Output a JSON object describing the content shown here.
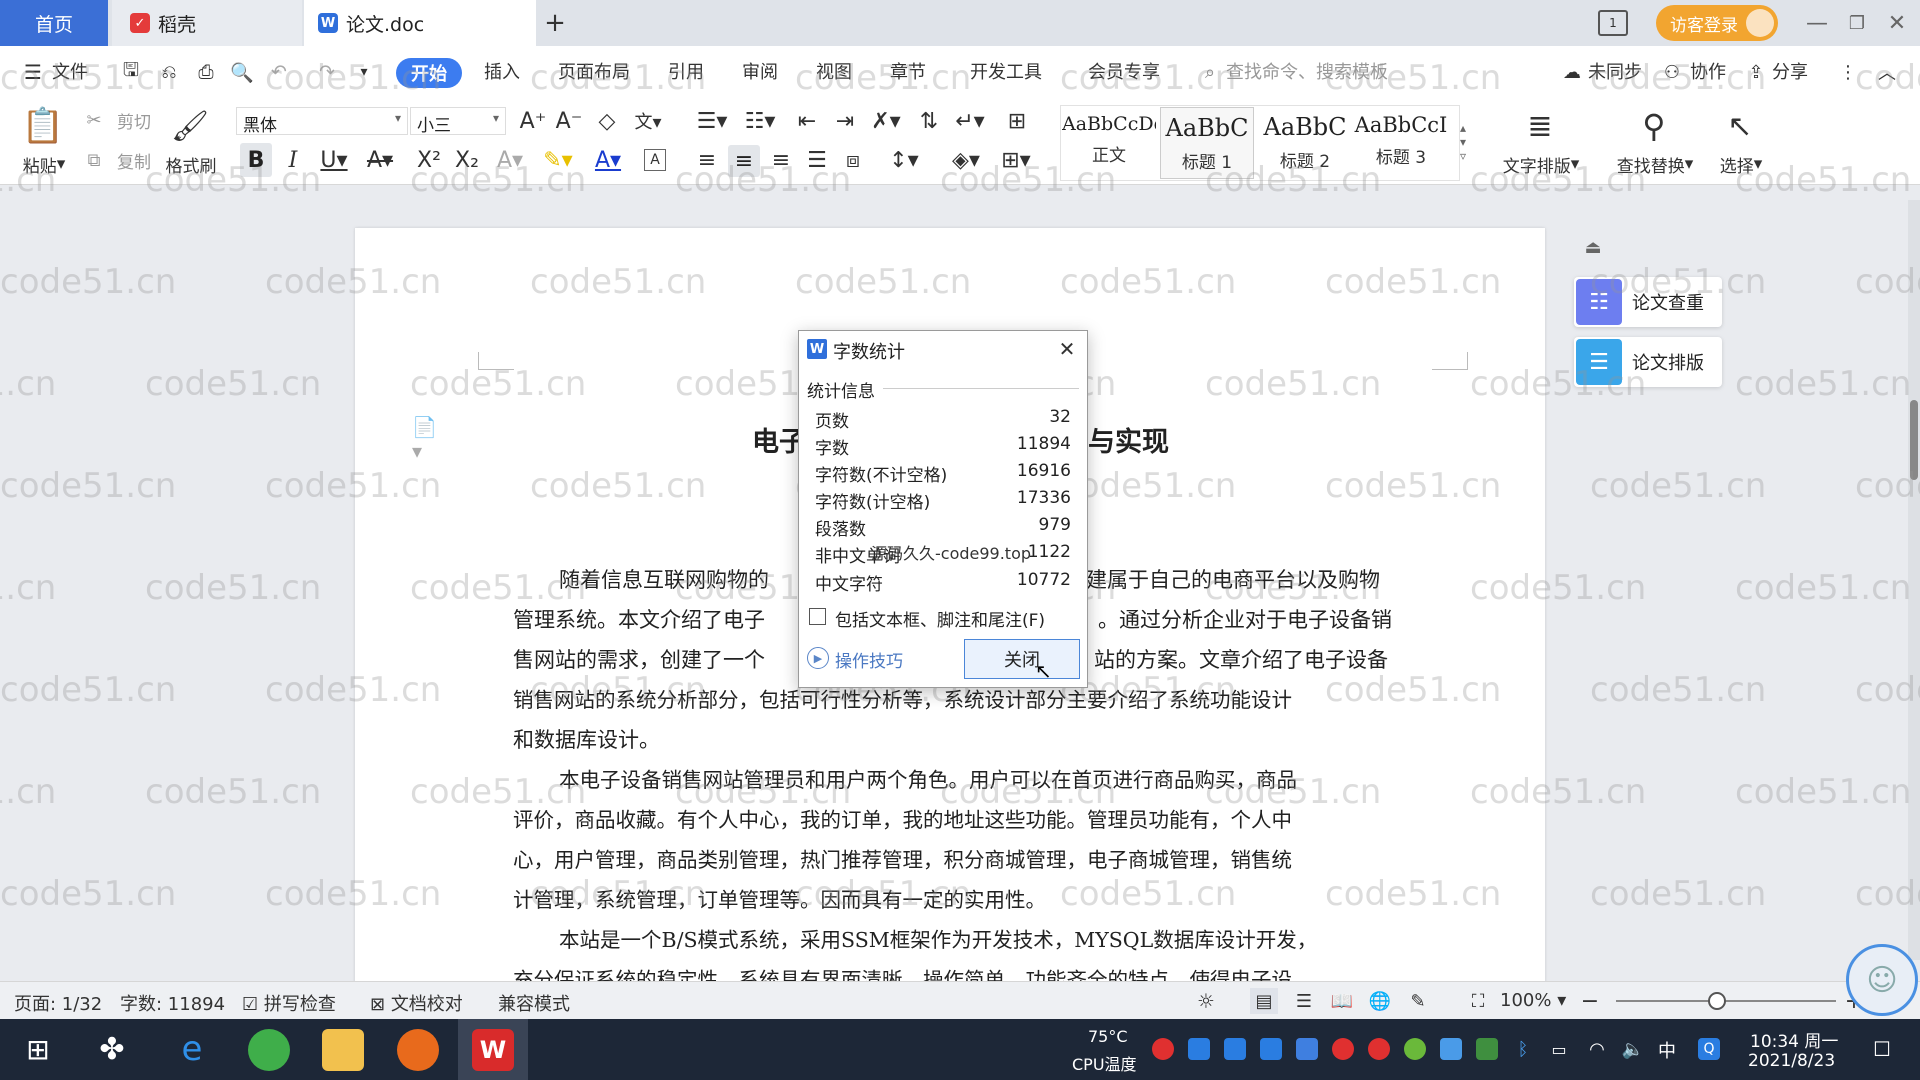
{
  "tabs": {
    "home": "首页",
    "daoke": "稻壳",
    "doc": "论文.doc",
    "login": "访客登录"
  },
  "menu": [
    "文件",
    "开始",
    "插入",
    "页面布局",
    "引用",
    "审阅",
    "视图",
    "章节",
    "开发工具",
    "会员专享"
  ],
  "search_placeholder": "查找命令、搜索模板",
  "menu_right": {
    "sync": "未同步",
    "collab": "协作",
    "share": "分享"
  },
  "ribbon": {
    "paste": "粘贴",
    "cut": "剪切",
    "copy": "复制",
    "format_painter": "格式刷",
    "font": "黑体",
    "size": "小三",
    "styles": [
      {
        "sample": "AaBbCcDd",
        "label": "正文"
      },
      {
        "sample": "AaBbC",
        "label": "标题 1"
      },
      {
        "sample": "AaBbC",
        "label": "标题 2"
      },
      {
        "sample": "AaBbCcI",
        "label": "标题 3"
      }
    ],
    "text_layout": "文字排版",
    "find_replace": "查找替换",
    "select": "选择"
  },
  "doc": {
    "title_left": "电子",
    "title_right": "与实现",
    "p1_lines": [
      "随着信息互联网购物的",
      "建属于自己的电商平台以及购物",
      "管理系统。本文介绍了电子",
      "。通过分析企业对于电子设备销",
      "售网站的需求，创建了一个",
      "站的方案。文章介绍了电子设备",
      "销售网站的系统分析部分，包括可行性分析等，系统设计部分主要介绍了系统功能设计",
      "和数据库设计。"
    ],
    "p2_lines": [
      "本电子设备销售网站管理员和用户两个角色。用户可以在首页进行商品购买，商品",
      "评价，商品收藏。有个人中心，我的订单，我的地址这些功能。管理员功能有，个人中",
      "心，用户管理，商品类别管理，热门推荐管理，积分商城管理，电子商城管理，销售统",
      "计管理，系统管理，订单管理等。因而具有一定的实用性。"
    ],
    "p3_line": "本站是一个B/S模式系统，采用SSM框架作为开发技术，MYSQL数据库设计开发，",
    "p3_partial": "充分保证系统的稳定性。系统具有界面清晰、操作简单，功能齐全的特点，使得电子设"
  },
  "dialog": {
    "title": "字数统计",
    "section": "统计信息",
    "rows": [
      {
        "label": "页数",
        "value": "32"
      },
      {
        "label": "字数",
        "value": "11894"
      },
      {
        "label": "字符数(不计空格)",
        "value": "16916"
      },
      {
        "label": "字符数(计空格)",
        "value": "17336"
      },
      {
        "label": "段落数",
        "value": "979"
      },
      {
        "label": "非中文单词",
        "value": "1122"
      },
      {
        "label": "中文字符",
        "value": "10772"
      }
    ],
    "overlay_text": "源码久久-code99.top",
    "checkbox": "包括文本框、脚注和尾注(F)",
    "tips": "操作技巧",
    "close": "关闭"
  },
  "right_panel": {
    "check": "论文查重",
    "layout": "论文排版"
  },
  "status": {
    "page": "页面: 1/32",
    "words": "字数: 11894",
    "spell": "拼写检查",
    "proof": "文档校对",
    "compat": "兼容模式",
    "zoom": "100%"
  },
  "taskbar": {
    "temp": "75°C",
    "temp_label": "CPU温度",
    "ime": "中",
    "time": "10:34 周一",
    "date": "2021/8/23"
  },
  "watermark": "code51.cn"
}
